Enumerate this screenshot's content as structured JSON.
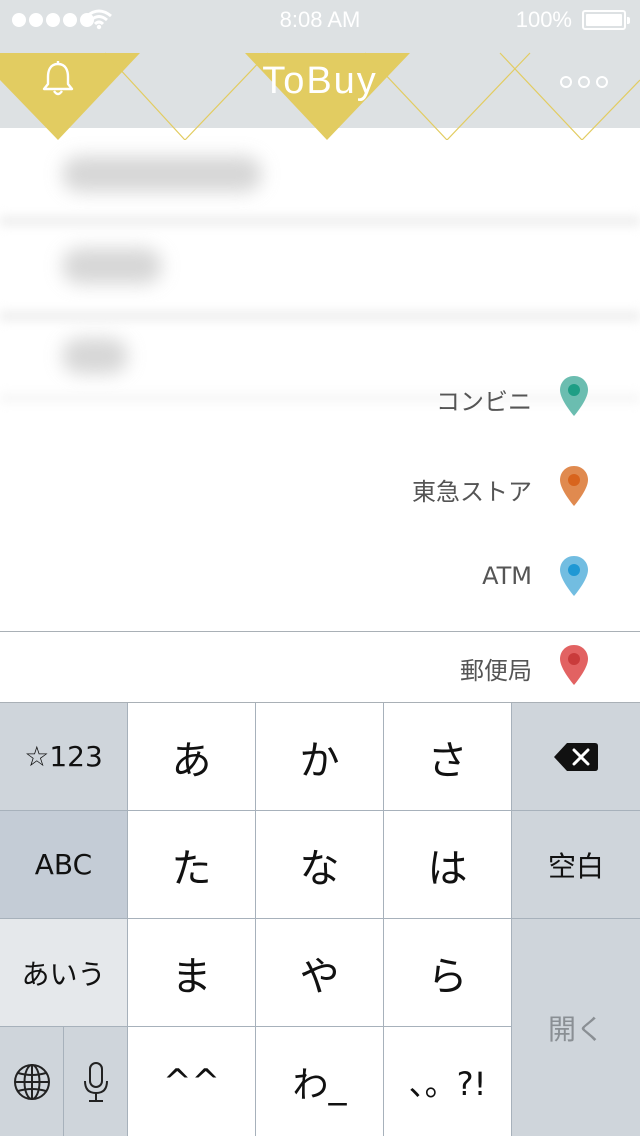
{
  "status_bar": {
    "time": "8:08 AM",
    "battery_percent": "100%",
    "battery_level": 1.0,
    "signal_bars": 5,
    "icons": [
      "signal-dots-icon",
      "wifi-icon",
      "battery-icon"
    ]
  },
  "nav": {
    "title": "ToBuy",
    "left_icon": "bell-icon",
    "right_icon": "more-dots-icon",
    "accent_color": "#e2cc61",
    "bar_color": "#dde1e3"
  },
  "locations": [
    {
      "label": "コンビニ",
      "pin_color": "#6bbdb0",
      "dot_color": "#1e9e85"
    },
    {
      "label": "東急ストア",
      "pin_color": "#e08a4f",
      "dot_color": "#d8641d"
    },
    {
      "label": "ATM",
      "pin_color": "#72bde1",
      "dot_color": "#1f98d4"
    },
    {
      "label": "郵便局",
      "pin_color": "#e26262",
      "dot_color": "#c93b3b"
    }
  ],
  "keyboard": {
    "left_keys": [
      "☆123",
      "ABC",
      "あいう"
    ],
    "kana_rows": [
      [
        "あ",
        "か",
        "さ"
      ],
      [
        "た",
        "な",
        "は"
      ],
      [
        "ま",
        "や",
        "ら"
      ],
      [
        "^^",
        "わ_",
        "、。?!"
      ]
    ],
    "space_label": "空白",
    "return_label": "開く",
    "icons": [
      "delete-icon",
      "globe-icon",
      "mic-icon"
    ]
  }
}
